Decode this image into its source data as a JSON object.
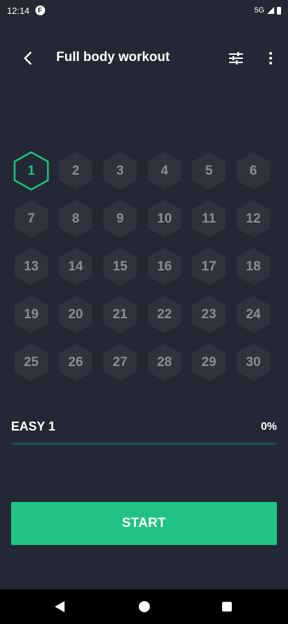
{
  "status_bar": {
    "time": "12:14",
    "badge": "F",
    "network": "5G"
  },
  "app_bar": {
    "title": "Full body workout",
    "back_icon": "arrow-back-icon",
    "tune_icon": "tune-sliders-icon",
    "more_icon": "more-vert-icon"
  },
  "days": [
    "1",
    "2",
    "3",
    "4",
    "5",
    "6",
    "7",
    "8",
    "9",
    "10",
    "11",
    "12",
    "13",
    "14",
    "15",
    "16",
    "17",
    "18",
    "19",
    "20",
    "21",
    "22",
    "23",
    "24",
    "25",
    "26",
    "27",
    "28",
    "29",
    "30"
  ],
  "current_day": "1",
  "level": {
    "label": "EASY 1",
    "percent_text": "0%",
    "progress": 0
  },
  "start_button": {
    "label": "START"
  },
  "colors": {
    "background": "#232834",
    "accent": "#20c384",
    "hex_inactive": "#2e333e",
    "text_inactive": "#8a8e97"
  },
  "nav_bar": {
    "back_icon": "nav-back-triangle-icon",
    "home_icon": "nav-home-circle-icon",
    "recents_icon": "nav-recents-square-icon"
  }
}
